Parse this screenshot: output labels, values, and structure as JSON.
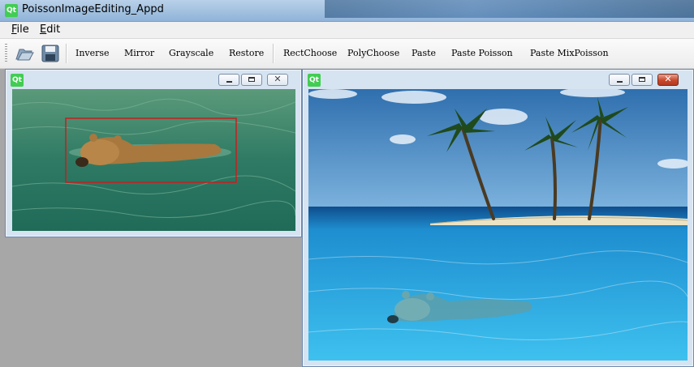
{
  "window": {
    "title": "PoissonImageEditing_Appd",
    "icon": "qt-logo-icon"
  },
  "menu": {
    "items": [
      "File",
      "Edit"
    ],
    "accelerators": [
      "F",
      "E"
    ]
  },
  "toolbar": {
    "icons": [
      "open-folder-icon",
      "save-disk-icon"
    ],
    "buttons": [
      "Inverse",
      "Mirror",
      "Grayscale",
      "Restore",
      "RectChoose",
      "PolyChoose",
      "Paste",
      "Paste Poisson",
      "Paste MixPoisson"
    ]
  },
  "source_window": {
    "badge": "Qt",
    "content": "photo of a bear swimming in green water with a red rectangular selection"
  },
  "target_window": {
    "badge": "Qt",
    "content": "photo of a tropical island with palm trees; pasted bear swimming in blue water"
  },
  "colors": {
    "selection": "#c81e1e",
    "workspace": "#a7a7a7",
    "qt_green": "#41cd52"
  }
}
